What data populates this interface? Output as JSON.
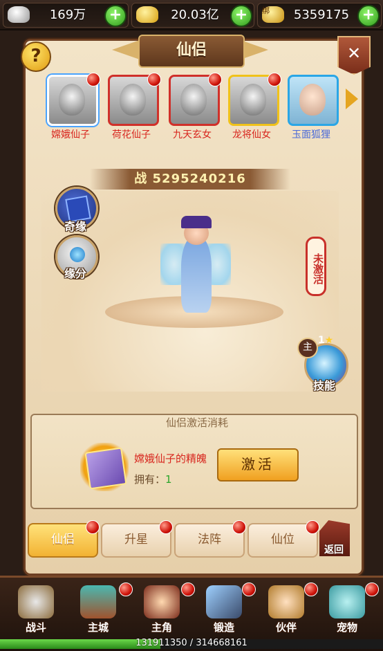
{
  "currency": [
    {
      "name": "silver",
      "value": "169万"
    },
    {
      "name": "gold",
      "value": "20.03亿"
    },
    {
      "name": "bound-gold",
      "icon_text": "绑",
      "value": "5359175"
    }
  ],
  "panel": {
    "title": "仙侣",
    "help_label": "?",
    "close_label": "✕"
  },
  "companions": [
    {
      "name": "嫦娥仙子",
      "selected": true
    },
    {
      "name": "荷花仙子"
    },
    {
      "name": "九天玄女"
    },
    {
      "name": "龙将仙女"
    },
    {
      "name": "玉面狐狸"
    }
  ],
  "battle_power": {
    "prefix": "战",
    "value": "5295240216"
  },
  "side_buttons": {
    "adventure": "奇缘",
    "fate": "缘分"
  },
  "status": "未激活",
  "skill": {
    "label": "技能",
    "main": "主",
    "stars": "1",
    "star_glyph": "★"
  },
  "cost": {
    "title": "仙侣激活消耗",
    "item_name": "嫦娥仙子的精魄",
    "own_label": "拥有：",
    "own_count": "1",
    "activate_label": "激活"
  },
  "tabs": [
    {
      "label": "仙侣",
      "active": true
    },
    {
      "label": "升星"
    },
    {
      "label": "法阵"
    },
    {
      "label": "仙位"
    }
  ],
  "back_label": "返回",
  "bottom_nav": [
    {
      "label": "战斗",
      "icon": "crossed-swords-icon"
    },
    {
      "label": "主城",
      "icon": "city-gate-icon"
    },
    {
      "label": "主角",
      "icon": "hero-portrait-icon"
    },
    {
      "label": "锻造",
      "icon": "anvil-icon"
    },
    {
      "label": "伙伴",
      "icon": "partner-portrait-icon"
    },
    {
      "label": "宠物",
      "icon": "pet-cat-icon"
    }
  ],
  "experience": {
    "current": "131911350",
    "max": "314668161",
    "text": "131911350 / 314668161",
    "fraction": 0.419
  },
  "colors": {
    "accent_red": "#d8261e",
    "gold": "#f0a020",
    "panel": "#f3e4c8"
  }
}
